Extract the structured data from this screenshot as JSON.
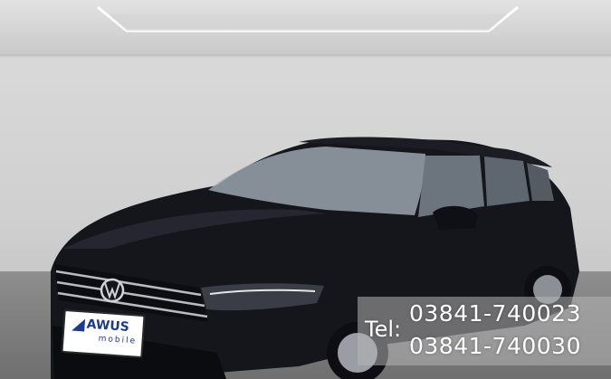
{
  "scene": {
    "subject": "car-photo",
    "colors": {
      "car_body": "#15161c",
      "wall": "#d2d2d2",
      "floor": "#7d7d7d"
    }
  },
  "plate": {
    "brand": "AWUS",
    "sub": "mobile"
  },
  "contact": {
    "label": "Tel:",
    "numbers": [
      "03841-740023",
      "03841-740030"
    ]
  }
}
